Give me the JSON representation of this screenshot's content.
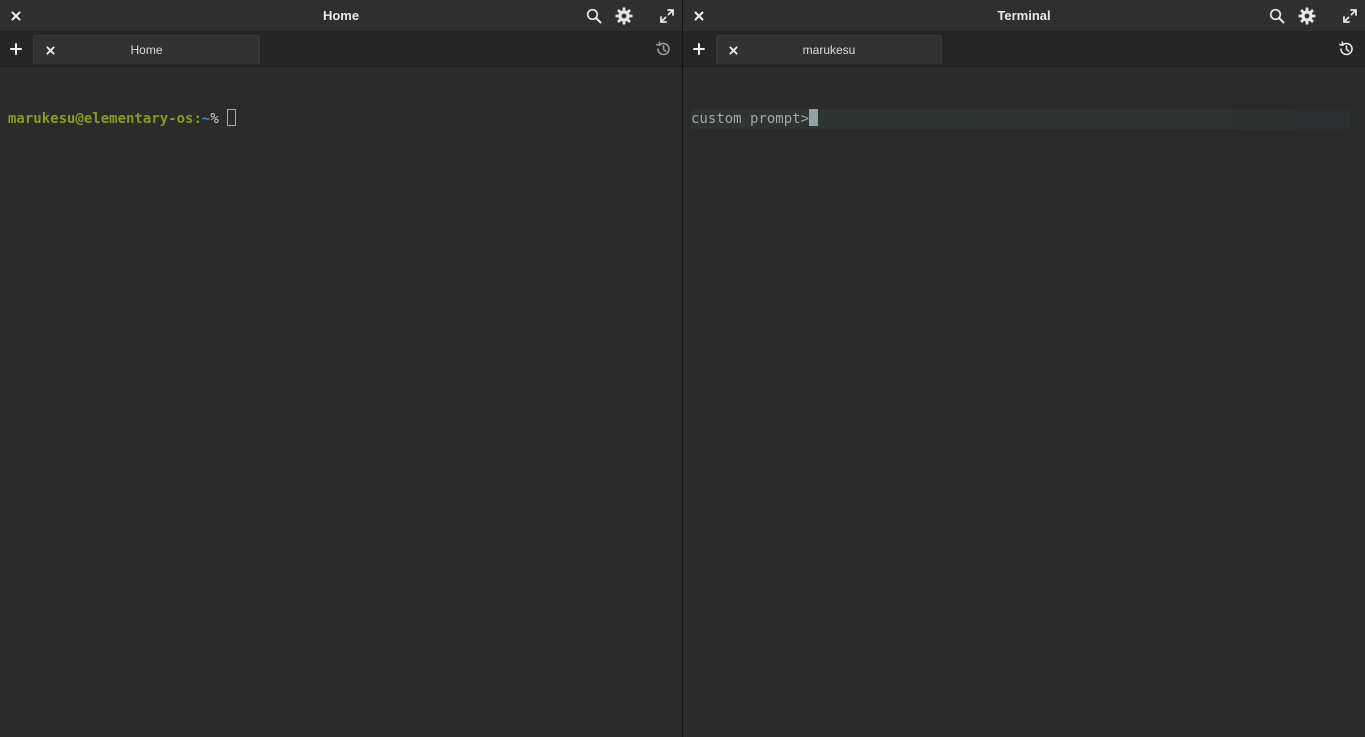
{
  "colors": {
    "background": "#2b2b2b",
    "prompt_user": "#8a9a1a",
    "prompt_path": "#3b8fd9",
    "text": "#a5a5a5",
    "cursor": "#8fa3a6"
  },
  "left_window": {
    "title": "Home",
    "tabs": [
      {
        "label": "Home"
      }
    ],
    "terminal": {
      "user_host": "marukesu@elementary-os",
      "separator": ":",
      "path": "~",
      "symbol": "%"
    },
    "icons": {
      "close": "close-icon",
      "search": "search-icon",
      "settings": "gear-icon",
      "maximize": "maximize-icon",
      "new_tab": "plus-icon",
      "history": "history-icon"
    }
  },
  "right_window": {
    "title": "Terminal",
    "tabs": [
      {
        "label": "marukesu"
      }
    ],
    "terminal": {
      "prompt": "custom prompt>"
    },
    "icons": {
      "close": "close-icon",
      "search": "search-icon",
      "settings": "gear-icon",
      "maximize": "maximize-icon",
      "new_tab": "plus-icon",
      "history": "history-icon"
    }
  }
}
